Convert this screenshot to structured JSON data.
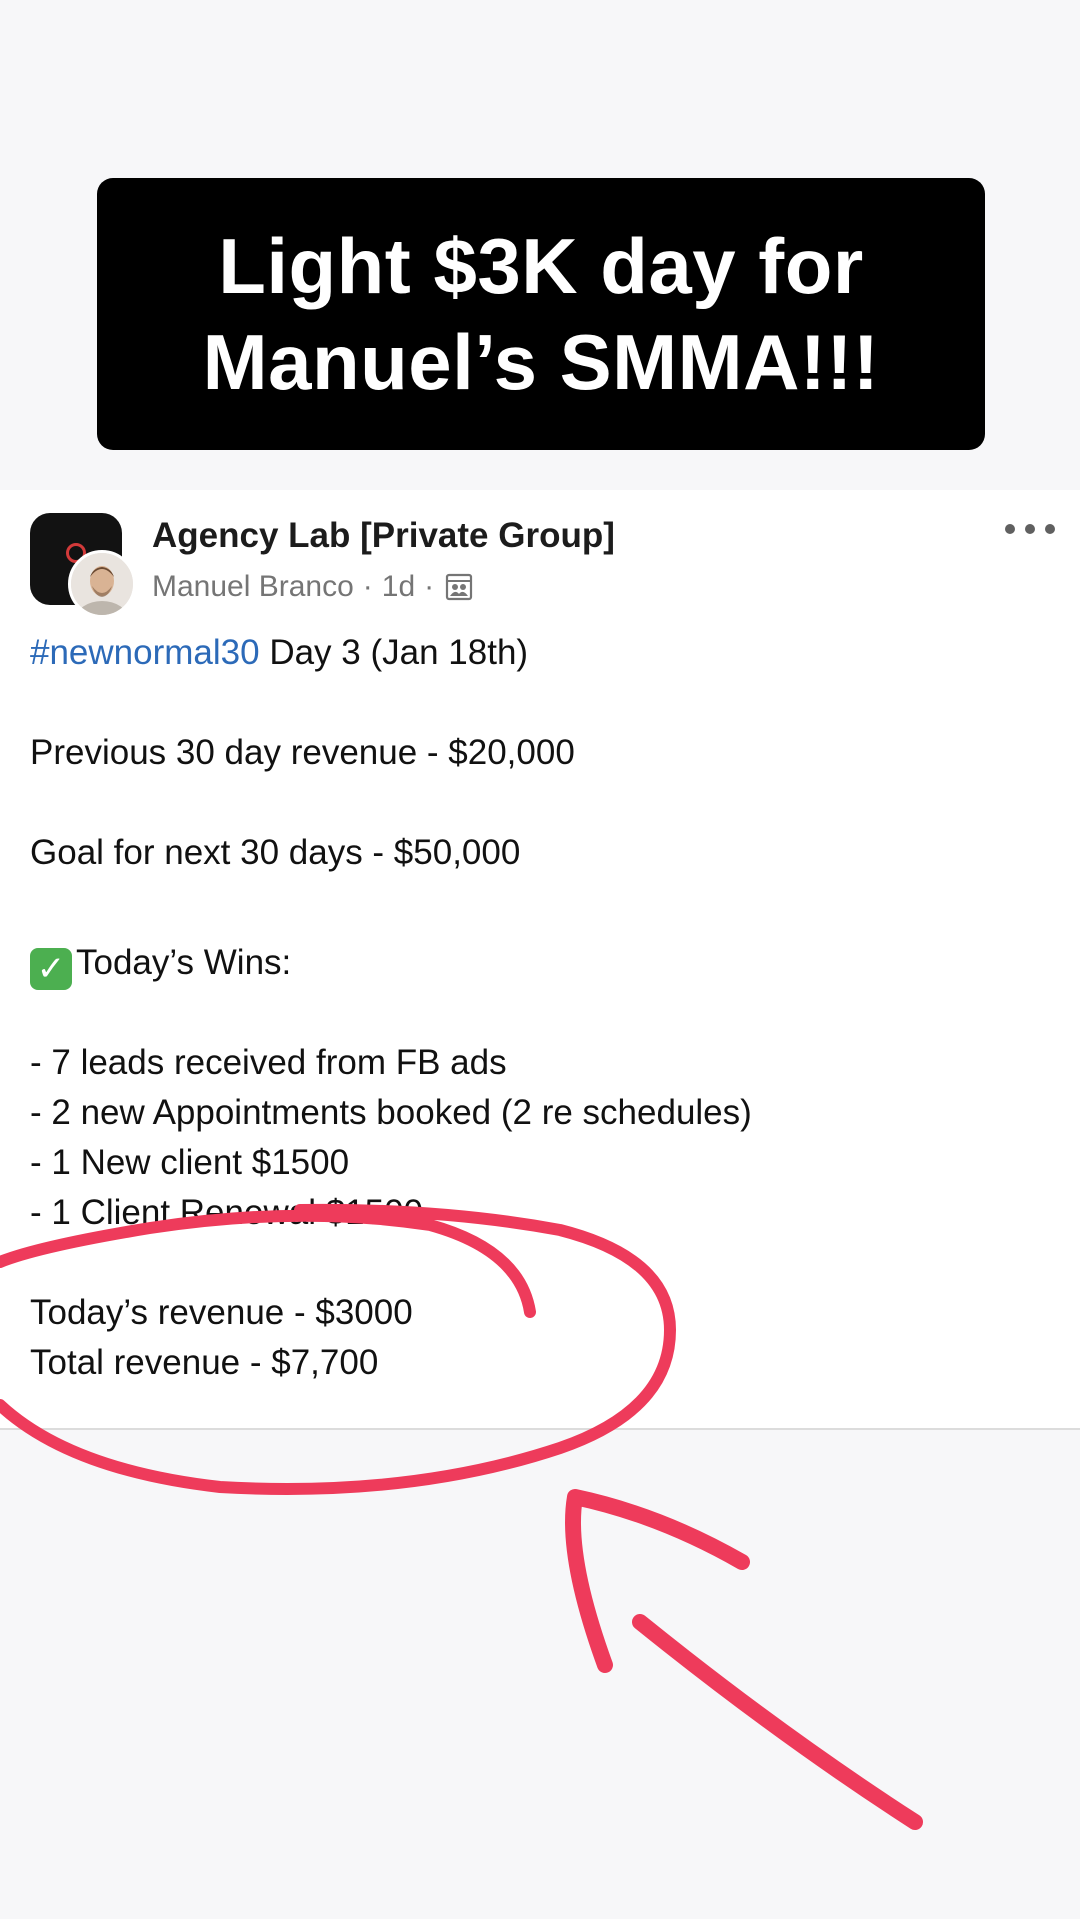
{
  "banner": {
    "text": "Light $3K day for\nManuel’s SMMA!!!"
  },
  "post": {
    "group_name": "Agency Lab [Private Group]",
    "author": "Manuel Branco",
    "time": "1d",
    "separator": "·",
    "body": {
      "hashtag": "#newnormal30",
      "day_line": " Day 3 (Jan 18th)",
      "previous_revenue": "Previous 30 day revenue - $20,000",
      "goal": "Goal for next 30 days - $50,000",
      "wins_emoji": "✓",
      "wins_title": "Today’s Wins:",
      "wins": [
        "- 7 leads received from FB ads",
        "- 2 new Appointments booked (2 re schedules)",
        "- 1 New client $1500",
        "- 1 Client Renewal $1500"
      ],
      "todays_revenue": "Today’s revenue - $3000",
      "total_revenue": "Total revenue - $7,700"
    }
  },
  "icons": {
    "more": "more-horizontal-icon",
    "privacy": "group-privacy-icon",
    "check": "check-mark-emoji-icon"
  },
  "colors": {
    "banner_bg": "#000000",
    "banner_text": "#ffffff",
    "hashtag": "#2c6ab8",
    "annotation": "#ee3b5b",
    "check_emoji": "#4caf50"
  }
}
